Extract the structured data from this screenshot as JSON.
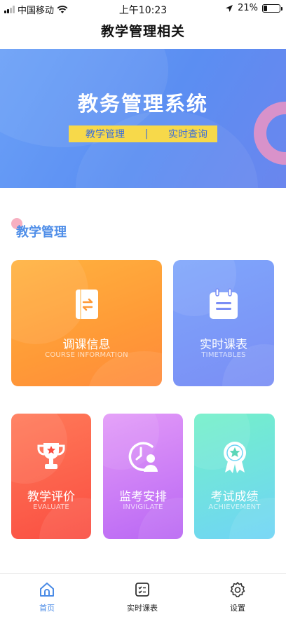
{
  "status_bar": {
    "carrier": "中国移动",
    "time": "上午10:23",
    "battery_text": "21%",
    "battery_level": 0.21
  },
  "nav": {
    "title": "教学管理相关"
  },
  "banner": {
    "title": "教务管理系统",
    "tags": [
      "教学管理",
      "|",
      "实时查询"
    ]
  },
  "section": {
    "title": "教学管理"
  },
  "cards": [
    {
      "title": "调课信息",
      "subtitle": "COURSE INFORMATION",
      "icon": "book-swap-icon"
    },
    {
      "title": "实时课表",
      "subtitle": "TIMETABLES",
      "icon": "calendar-icon"
    },
    {
      "title": "教学评价",
      "subtitle": "EVALUATE",
      "icon": "trophy-icon"
    },
    {
      "title": "监考安排",
      "subtitle": "INVIGILATE",
      "icon": "clock-person-icon"
    },
    {
      "title": "考试成绩",
      "subtitle": "ACHIEVEMENT",
      "icon": "medal-icon"
    }
  ],
  "tabbar": {
    "items": [
      {
        "label": "首页",
        "icon": "home-icon",
        "active": true
      },
      {
        "label": "实时课表",
        "icon": "checklist-icon",
        "active": false
      },
      {
        "label": "设置",
        "icon": "gear-icon",
        "active": false
      }
    ]
  },
  "colors": {
    "accent": "#4a8be6",
    "banner": "#5b8ef2",
    "tag_bg": "#f7d94a"
  }
}
